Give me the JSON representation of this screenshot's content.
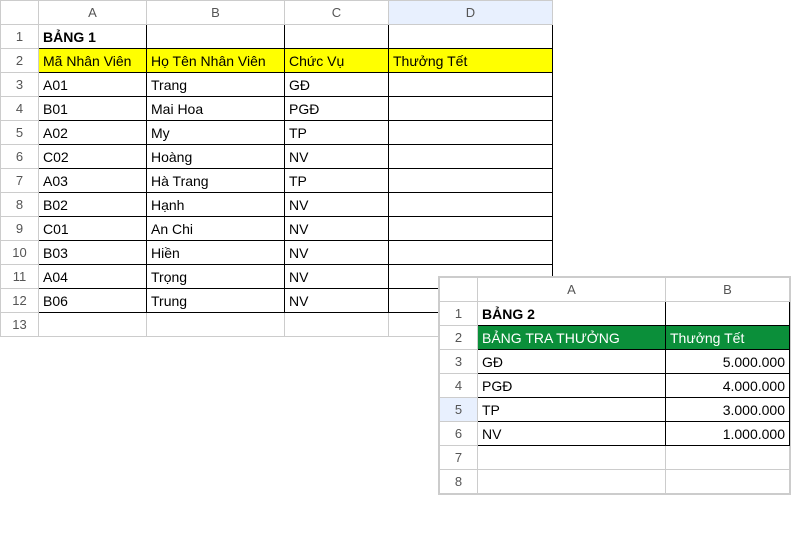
{
  "sheet1": {
    "cols": [
      "A",
      "B",
      "C",
      "D"
    ],
    "rows": [
      "1",
      "2",
      "3",
      "4",
      "5",
      "6",
      "7",
      "8",
      "9",
      "10",
      "11",
      "12",
      "13"
    ],
    "title": "BẢNG 1",
    "headers": {
      "a": "Mã Nhân Viên",
      "b": "Họ Tên Nhân Viên",
      "c": "Chức Vụ",
      "d": "Thưởng Tết"
    },
    "data": [
      {
        "a": "A01",
        "b": "Trang",
        "c": "GĐ",
        "d": ""
      },
      {
        "a": "B01",
        "b": "Mai Hoa",
        "c": "PGĐ",
        "d": ""
      },
      {
        "a": "A02",
        "b": "My",
        "c": "TP",
        "d": ""
      },
      {
        "a": "C02",
        "b": "Hoàng",
        "c": "NV",
        "d": ""
      },
      {
        "a": "A03",
        "b": "Hà Trang",
        "c": "TP",
        "d": ""
      },
      {
        "a": "B02",
        "b": "Hạnh",
        "c": "NV",
        "d": ""
      },
      {
        "a": "C01",
        "b": "An Chi",
        "c": "NV",
        "d": ""
      },
      {
        "a": "B03",
        "b": "Hiền",
        "c": "NV",
        "d": ""
      },
      {
        "a": "A04",
        "b": "Trọng",
        "c": "NV",
        "d": ""
      },
      {
        "a": "B06",
        "b": "Trung",
        "c": "NV",
        "d": ""
      }
    ],
    "selected_col": "D"
  },
  "sheet2": {
    "cols": [
      "A",
      "B"
    ],
    "rows": [
      "1",
      "2",
      "3",
      "4",
      "5",
      "6",
      "7",
      "8"
    ],
    "title": "BẢNG 2",
    "headers": {
      "a": "BẢNG TRA THƯỞNG",
      "b": "Thưởng Tết"
    },
    "data": [
      {
        "a": "GĐ",
        "b": "5.000.000"
      },
      {
        "a": "PGĐ",
        "b": "4.000.000"
      },
      {
        "a": "TP",
        "b": "3.000.000"
      },
      {
        "a": "NV",
        "b": "1.000.000"
      }
    ],
    "selected_row": "5"
  }
}
